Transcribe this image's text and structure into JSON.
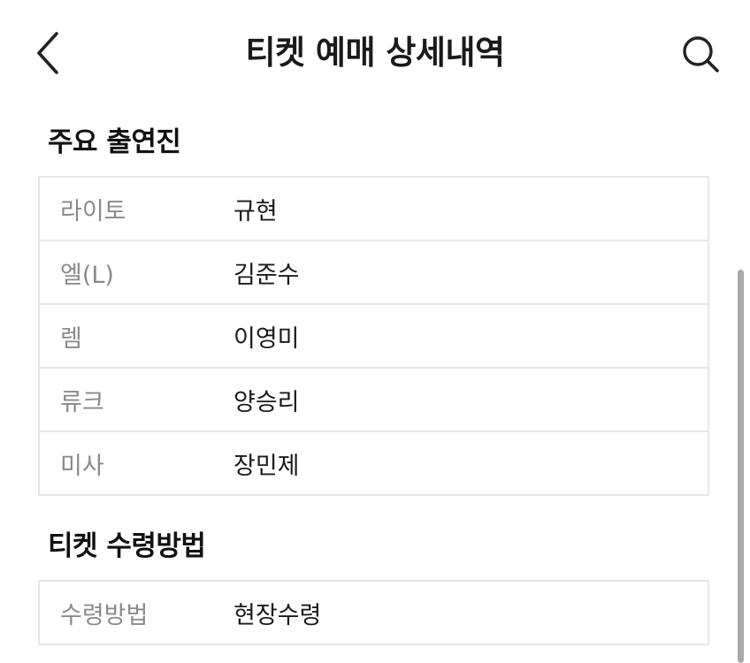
{
  "header": {
    "title": "티켓 예매 상세내역",
    "back_icon": "chevron-left-icon",
    "search_icon": "search-icon"
  },
  "cast_section": {
    "title": "주요 출연진",
    "rows": [
      {
        "role": "라이토",
        "actor": "규현"
      },
      {
        "role": "엘(L)",
        "actor": "김준수"
      },
      {
        "role": "렘",
        "actor": "이영미"
      },
      {
        "role": "류크",
        "actor": "양승리"
      },
      {
        "role": "미사",
        "actor": "장민제"
      }
    ]
  },
  "ticket_section": {
    "title": "티켓 수령방법",
    "rows": [
      {
        "label": "수령방법",
        "value": "현장수령"
      }
    ]
  },
  "colors": {
    "text_primary": "#111111",
    "text_secondary": "#8a8a8a",
    "border": "#e6e6e6",
    "scrollbar": "#a9a9a9"
  }
}
